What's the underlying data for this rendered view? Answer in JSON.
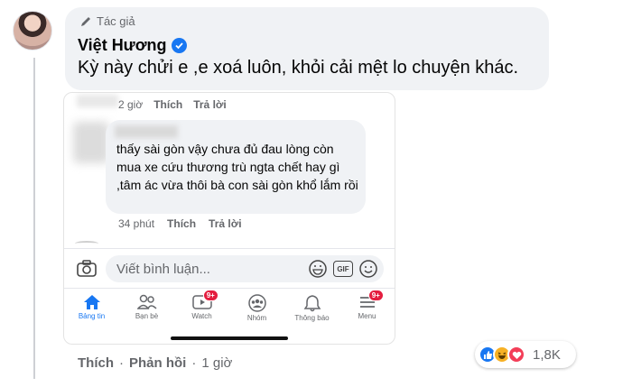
{
  "comment": {
    "author_badge": "Tác giả",
    "author_name": "Việt Hương",
    "text": "Kỳ này chửi e ,e xoá luôn, khỏi cải mệt lo chuyện khác.",
    "actions": {
      "like": "Thích",
      "reply": "Phản hồi",
      "time": "1 giờ"
    },
    "reactions_count": "1,8K"
  },
  "screenshot": {
    "top_meta": {
      "time": "2 giờ",
      "like": "Thích",
      "reply": "Trả lời"
    },
    "quoted_comment": "thấy sài gòn vậy chưa đủ đau lòng còn mua xe cứu thương trù ngta chết hay gì ,tâm ác vừa thôi bà con sài gòn khổ lắm rồi",
    "bottom_meta": {
      "time": "34 phút",
      "like": "Thích",
      "reply": "Trả lời"
    },
    "composer_placeholder": "Viết bình luận...",
    "gif_label": "GIF",
    "tabs": [
      {
        "label": "Bảng tin",
        "icon": "home-icon",
        "badge": ""
      },
      {
        "label": "Bạn bè",
        "icon": "friends-icon",
        "badge": ""
      },
      {
        "label": "Watch",
        "icon": "watch-icon",
        "badge": "9+"
      },
      {
        "label": "Nhóm",
        "icon": "groups-icon",
        "badge": ""
      },
      {
        "label": "Thông báo",
        "icon": "bell-icon",
        "badge": ""
      },
      {
        "label": "Menu",
        "icon": "menu-icon",
        "badge": "9+"
      }
    ]
  },
  "colors": {
    "accent": "#1877f2",
    "bubble": "#f0f2f5",
    "muted": "#65676b",
    "badge": "#e41e3f"
  }
}
